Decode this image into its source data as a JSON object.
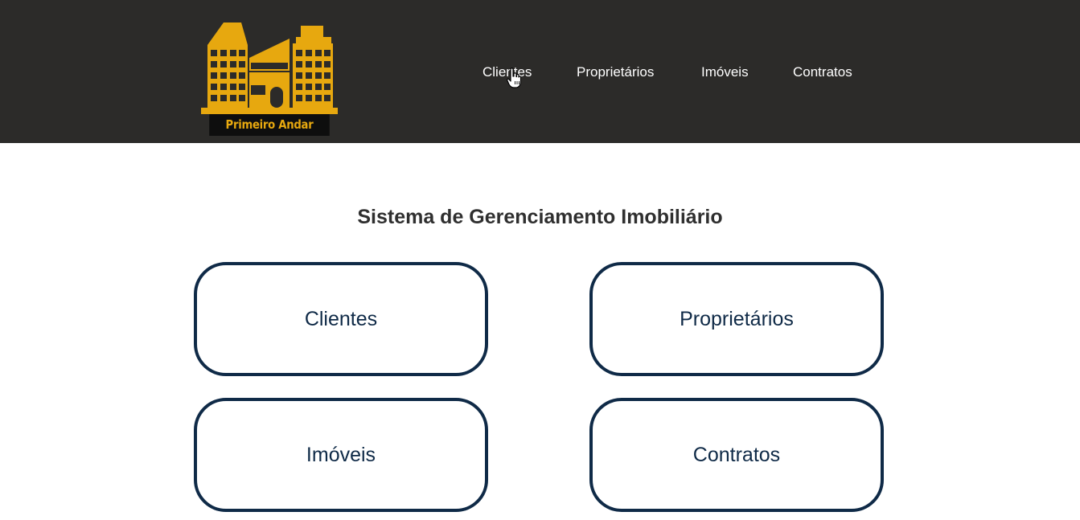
{
  "header": {
    "brand": "Primeiro Andar",
    "nav": [
      {
        "label": "Clientes"
      },
      {
        "label": "Proprietários"
      },
      {
        "label": "Imóveis"
      },
      {
        "label": "Contratos"
      }
    ]
  },
  "main": {
    "title": "Sistema de Gerenciamento Imobiliário",
    "cards": [
      {
        "label": "Clientes"
      },
      {
        "label": "Proprietários"
      },
      {
        "label": "Imóveis"
      },
      {
        "label": "Contratos"
      }
    ]
  },
  "colors": {
    "header_bg": "#2c2b29",
    "brand_gold": "#e7a80f",
    "card_border": "#0f2a47",
    "title_text": "#2f2f2f"
  },
  "icons": [
    "building-logo-icon",
    "hand-cursor-icon"
  ]
}
